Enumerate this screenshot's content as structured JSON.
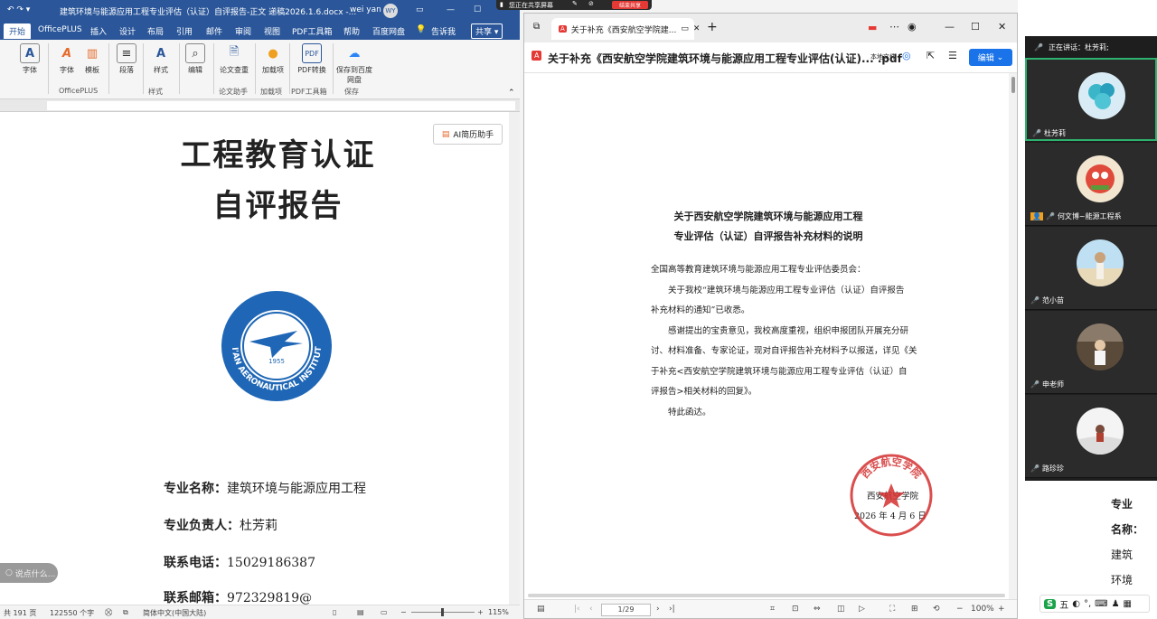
{
  "share_bar": {
    "status": "您正在共享屏幕",
    "stop_label": "结束共享"
  },
  "word": {
    "title": "建筑环境与能源应用工程专业评估（认证）自评报告-正文 递稿2026.1.6.docx  -...",
    "user": "wei yan",
    "user_initials": "WY",
    "tabs": [
      "开始",
      "OfficePLUS",
      "插入",
      "设计",
      "布局",
      "引用",
      "邮件",
      "审阅",
      "视图",
      "PDF工具箱",
      "帮助",
      "百度网盘"
    ],
    "tell_me": "告诉我",
    "share_label": "共享",
    "ribbon": {
      "buttons": [
        "字体",
        "字体",
        "模板",
        "段落",
        "样式",
        "编辑",
        "论文查重",
        "加载项",
        "PDF转换",
        "保存到百度网盘"
      ],
      "groups": [
        "OfficePLUS",
        "样式",
        "论文助手",
        "加载项",
        "PDF工具箱",
        "保存"
      ]
    },
    "ai_resume": "AI简历助手",
    "doc": {
      "title_line1": "工程教育认证",
      "title_line2": "自评报告",
      "logo_year": "1955",
      "logo_text": "XI'AN AERONAUTICAL INSTITUTE",
      "fields": [
        {
          "label": "专业名称：",
          "value": "建筑环境与能源应用工程"
        },
        {
          "label": "专业负责人：",
          "value": "杜芳莉"
        },
        {
          "label": "联系电话：",
          "value": "15029186387"
        },
        {
          "label": "联系邮箱：",
          "value": "972329819@"
        }
      ]
    },
    "say_something": "说点什么...",
    "status": {
      "pages": "共 191 页",
      "words": "122550 个字",
      "language": "简体中文(中国大陆)",
      "zoom": "115%"
    }
  },
  "pdf": {
    "tab_title": "关于补充《西安航空学院建...",
    "filename": "关于补充《西安航空学院建筑环境与能源应用工程专业评估(认证)... .pdf",
    "local_file": "本地文件",
    "edit_label": "编辑",
    "heading_line1": "关于西安航空学院建筑环境与能源应用工程",
    "heading_line2": "专业评估（认证）自评报告补充材料的说明",
    "addressee": "全国高等教育建筑环境与能源应用工程专业评估委员会：",
    "para1_line1": "关于我校“建筑环境与能源应用工程专业评估（认证）自评报告",
    "para1_line2": "补充材料的通知”已收悉。",
    "para2_line1": "感谢提出的宝贵意见，我校高度重视，组织申报团队开展充分研",
    "para2_line2": "讨、材料准备、专家论证，现对自评报告补充材料予以报送，详见《关",
    "para2_line3": "于补充<西安航空学院建筑环境与能源应用工程专业评估（认证）自",
    "para2_line4": "评报告>相关材料的回复》。",
    "closing": "特此函达。",
    "signature_org": "西安航空学院",
    "signature_date": "2026 年 4 月 6 日",
    "seal_text": "西安航空学院",
    "page_indicator": "1/29",
    "zoom": "100%"
  },
  "meeting": {
    "speaking_label": "正在讲话：杜芳莉;",
    "participants": [
      {
        "name": "杜芳莉"
      },
      {
        "name": "何文博~能源工程系"
      },
      {
        "name": "范小苗"
      },
      {
        "name": "申老师"
      },
      {
        "name": "路珍珍"
      }
    ]
  },
  "right_doc": {
    "lines": [
      "专业",
      "名称：",
      "建筑",
      "环境"
    ]
  },
  "ime": {
    "label": "五"
  },
  "colors": {
    "word_blue": "#2b579a",
    "pdf_blue": "#1a73e8",
    "seal_red": "#d32f2f",
    "meeting_green": "#2db36f"
  }
}
